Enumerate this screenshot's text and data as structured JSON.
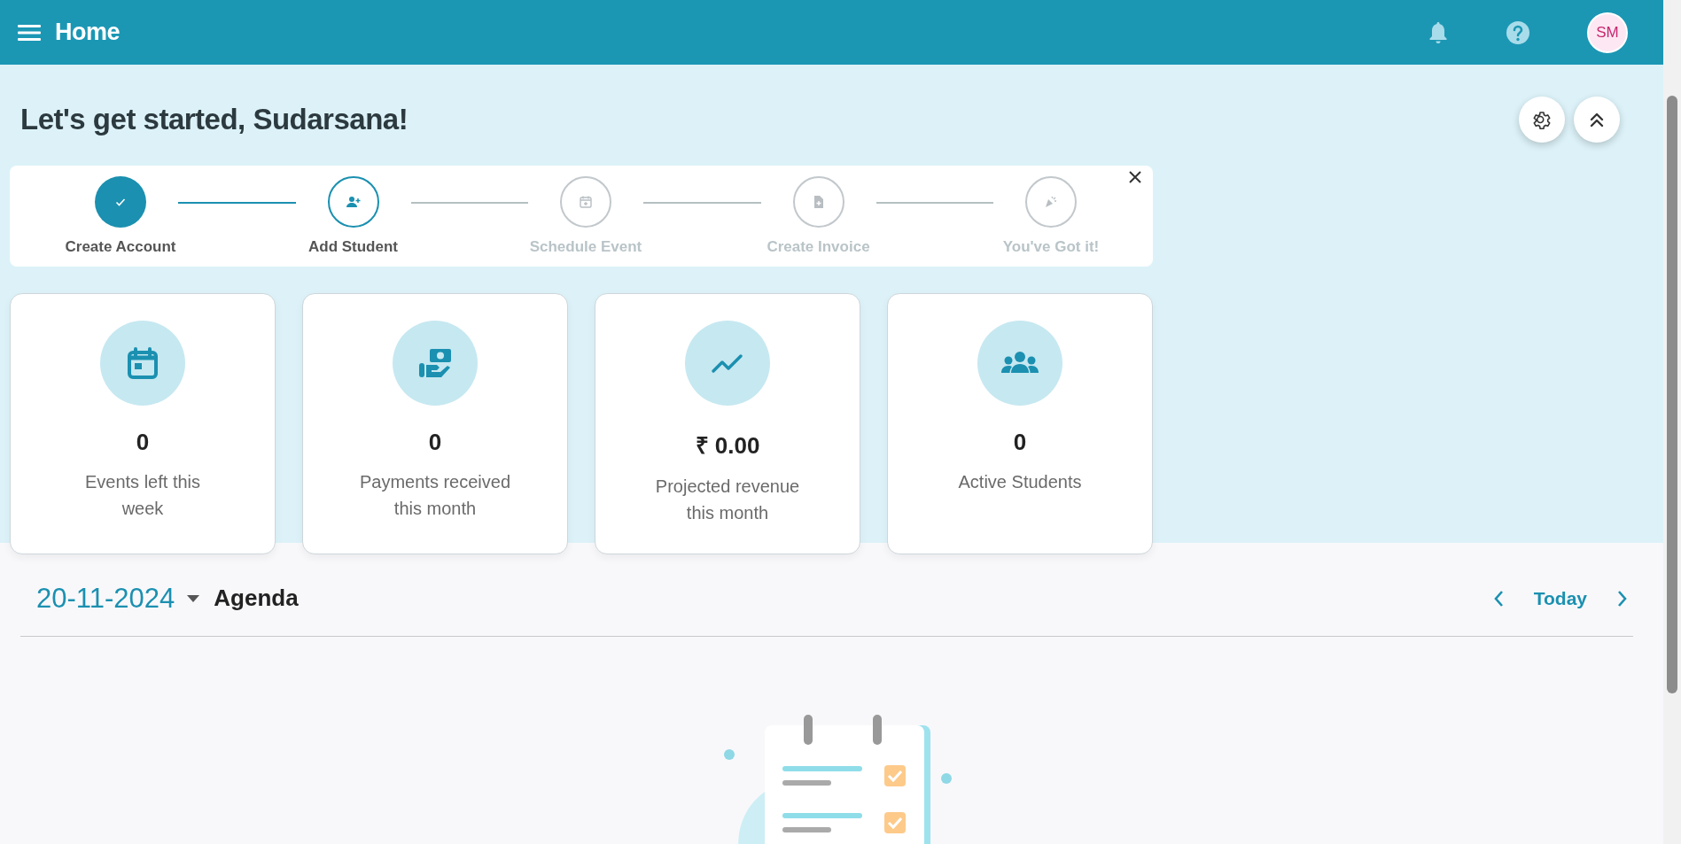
{
  "header": {
    "title": "Home",
    "avatar": "SM"
  },
  "greeting": "Let's get started, Sudarsana!",
  "stepper": {
    "steps": [
      {
        "label": "Create Account",
        "completed": true,
        "selected": false
      },
      {
        "label": "Add Student",
        "completed": false,
        "selected": true
      },
      {
        "label": "Schedule Event",
        "completed": false,
        "selected": false
      },
      {
        "label": "Create Invoice",
        "completed": false,
        "selected": false
      },
      {
        "label": "You've Got it!",
        "completed": false,
        "selected": false
      }
    ]
  },
  "stats": [
    {
      "value": "0",
      "label": "Events left this week",
      "kind": "events"
    },
    {
      "value": "0",
      "label": "Payments received this month",
      "kind": "payments"
    },
    {
      "value": "₹ 0.00",
      "label": "Projected revenue this month",
      "kind": "revenue"
    },
    {
      "value": "0",
      "label": "Active Students",
      "kind": "students"
    }
  ],
  "agenda": {
    "date": "20-11-2024",
    "view": "Agenda",
    "today": "Today"
  }
}
